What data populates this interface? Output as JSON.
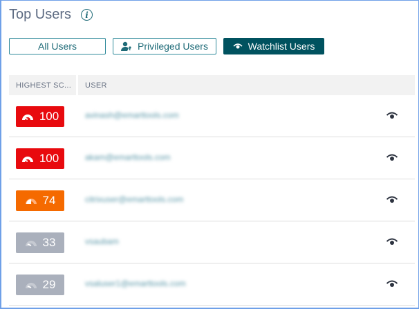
{
  "header": {
    "title": "Top Users",
    "info_icon": "i"
  },
  "filters": [
    {
      "label": "All Users",
      "icon": "",
      "active": false
    },
    {
      "label": "Privileged Users",
      "icon": "user-key-icon",
      "active": false
    },
    {
      "label": "Watchlist Users",
      "icon": "eye-icon",
      "active": true
    }
  ],
  "table": {
    "columns": [
      "HIGHEST SC...",
      "USER"
    ],
    "rows": [
      {
        "score": "100",
        "level": "high",
        "color": "#e80a0e",
        "user": "avinash@emarttools.com"
      },
      {
        "score": "100",
        "level": "high",
        "color": "#e80a0e",
        "user": "akam@emarttools.com"
      },
      {
        "score": "74",
        "level": "medium",
        "color": "#f56a00",
        "user": "citrixuser@emarttools.com"
      },
      {
        "score": "33",
        "level": "low",
        "color": "#aab0bc",
        "user": "vsaubam"
      },
      {
        "score": "29",
        "level": "low",
        "color": "#aab0bc",
        "user": "vsaluser1@emarttools.com"
      }
    ]
  }
}
